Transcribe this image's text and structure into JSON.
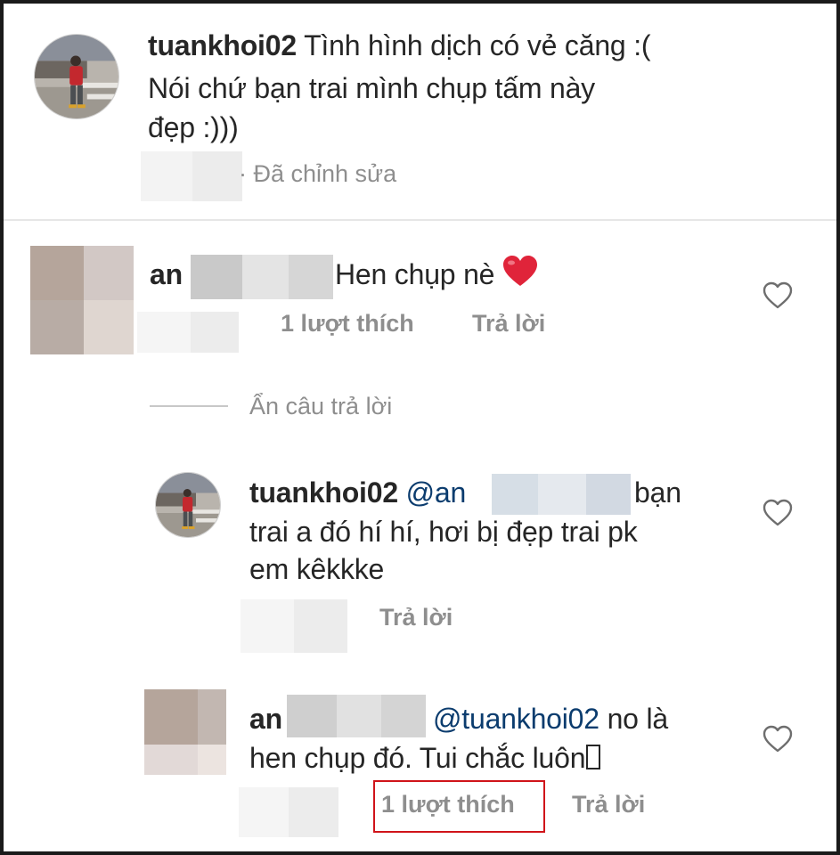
{
  "post": {
    "username": "tuankhoi02",
    "caption_line1": "Tình hình dịch có vẻ căng :(",
    "caption_line2": "Nói chứ bạn trai mình chụp tấm này",
    "caption_line3": "đẹp :)))",
    "edited_label": "· Đã chỉnh sửa"
  },
  "comments": [
    {
      "username_visible": "an",
      "text": "Hen chụp nè",
      "likes_label": "1 lượt thích",
      "reply_label": "Trả lời"
    }
  ],
  "hide_replies_label": "Ẩn câu trả lời",
  "replies": [
    {
      "username": "tuankhoi02",
      "mention_visible": "@an",
      "line1_end": "bạn",
      "line2": "trai a đó hí hí, hơi bị đẹp trai pk",
      "line3": "em kêkkke",
      "reply_label": "Trả lời"
    },
    {
      "username_visible": "an",
      "mention": "@tuankhoi02",
      "line1_end": "no là",
      "line2": "hen chụp đó. Tui chắc luôn",
      "likes_label": "1 lượt thích",
      "reply_label": "Trả lời"
    }
  ],
  "colors": {
    "text": "#262626",
    "muted": "#8e8e8e",
    "highlight": "#d0141a",
    "heart_emoji": "#e0243a"
  },
  "icons": [
    "heart-outline-icon",
    "red-heart-emoji"
  ]
}
